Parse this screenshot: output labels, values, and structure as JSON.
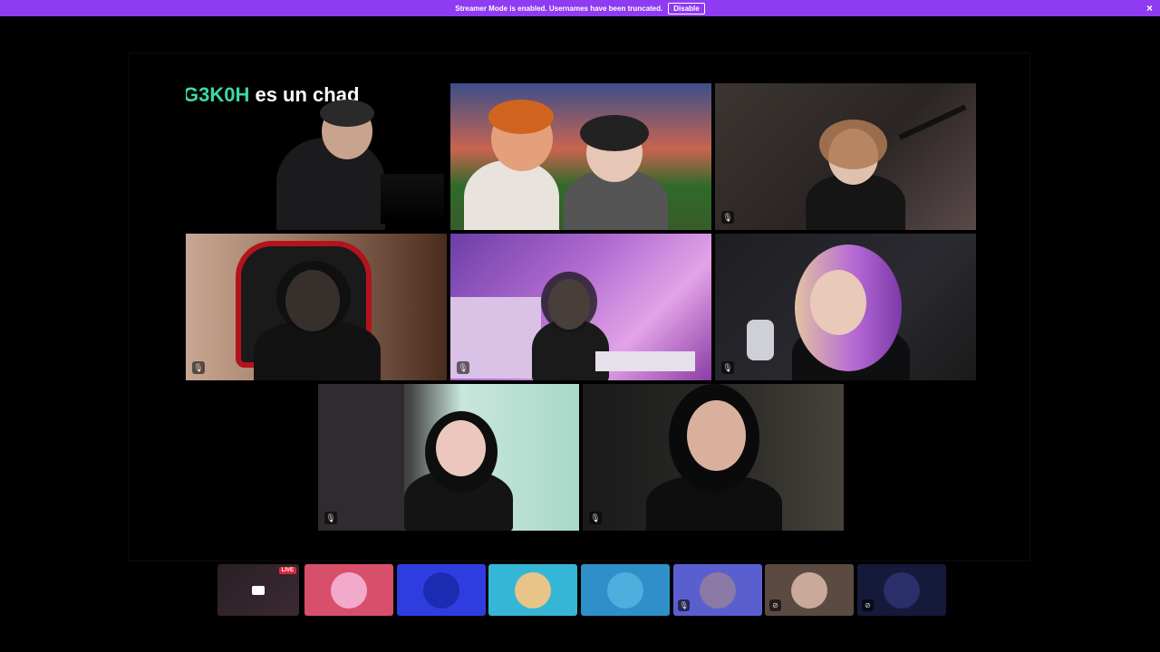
{
  "banner": {
    "message": "Streamer Mode is enabled. Usernames have been truncated.",
    "disable_label": "Disable",
    "close_glyph": "×",
    "color": "#8e3bf2"
  },
  "stream_overlay": {
    "highlight": "G3K0H",
    "rest": " es un chad"
  },
  "stream_tiles": [
    {
      "id": "tile-1",
      "muted": false
    },
    {
      "id": "tile-2",
      "muted": false
    },
    {
      "id": "tile-3",
      "muted": true
    },
    {
      "id": "tile-4",
      "muted": true
    },
    {
      "id": "tile-5",
      "muted": true
    },
    {
      "id": "tile-6",
      "muted": true
    },
    {
      "id": "tile-7",
      "muted": true
    },
    {
      "id": "tile-8",
      "muted": true
    }
  ],
  "participant_strip": {
    "live_badge": "LIVE",
    "mute_glyph": "🎙",
    "deafen_glyph": "⊘"
  },
  "colors": {
    "thumb_pink": "#d84f6b",
    "thumb_blue": "#2f3de0",
    "thumb_cyan": "#36b6d6",
    "thumb_steel": "#2f8fc8",
    "thumb_purple": "#5a5fd0",
    "thumb_brown": "#5a4a42",
    "thumb_navy": "#151a3a"
  }
}
